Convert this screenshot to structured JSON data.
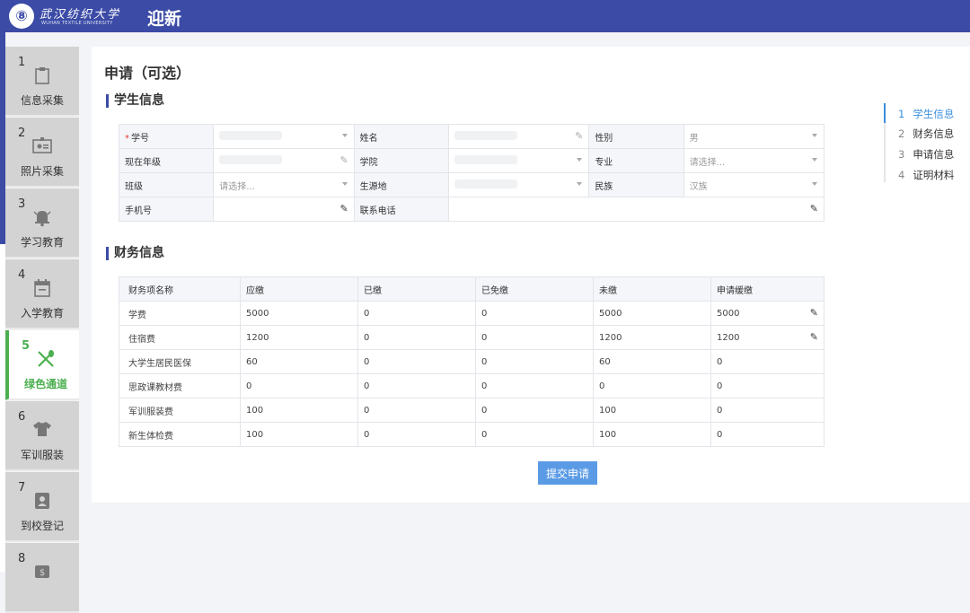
{
  "header": {
    "logo_glyph": "⑧",
    "university_name": "武汉纺织大学",
    "university_name_en": "WUHAN TEXTILE UNIVERSITY",
    "app_title": "迎新"
  },
  "sidebar": {
    "items": [
      {
        "num": "1",
        "label": "信息采集",
        "icon": "clipboard-icon"
      },
      {
        "num": "2",
        "label": "照片采集",
        "icon": "id-card-icon"
      },
      {
        "num": "3",
        "label": "学习教育",
        "icon": "bell-icon"
      },
      {
        "num": "4",
        "label": "入学教育",
        "icon": "calendar-icon"
      },
      {
        "num": "5",
        "label": "绿色通道",
        "icon": "fork-spoon-icon",
        "active": true
      },
      {
        "num": "6",
        "label": "军训服装",
        "icon": "tshirt-icon"
      },
      {
        "num": "7",
        "label": "到校登记",
        "icon": "badge-icon"
      },
      {
        "num": "8",
        "label": "",
        "icon": "money-icon"
      }
    ],
    "active_color": "#4caf50"
  },
  "page": {
    "title": "申请（可选）",
    "section_student": "学生信息",
    "section_finance": "财务信息",
    "submit_label": "提交申请"
  },
  "student_info": {
    "student_id_label": "学号",
    "name_label": "姓名",
    "gender_label": "性别",
    "gender_value": "男",
    "grade_label": "现在年级",
    "college_label": "学院",
    "major_label": "专业",
    "major_placeholder": "请选择...",
    "class_label": "班级",
    "class_placeholder": "请选择...",
    "origin_label": "生源地",
    "ethnicity_label": "民族",
    "ethnicity_value": "汉族",
    "phone_label": "手机号",
    "contact_label": "联系电话"
  },
  "finance": {
    "columns": [
      "财务项名称",
      "应缴",
      "已缴",
      "已免缴",
      "未缴",
      "申请缓缴"
    ],
    "rows": [
      [
        "学费",
        "5000",
        "0",
        "0",
        "5000",
        "5000"
      ],
      [
        "住宿费",
        "1200",
        "0",
        "0",
        "1200",
        "1200"
      ],
      [
        "大学生居民医保",
        "60",
        "0",
        "0",
        "60",
        "0"
      ],
      [
        "思政课教材费",
        "0",
        "0",
        "0",
        "0",
        "0"
      ],
      [
        "军训服装费",
        "100",
        "0",
        "0",
        "100",
        "0"
      ],
      [
        "新生体检费",
        "100",
        "0",
        "0",
        "100",
        "0"
      ]
    ]
  },
  "anchor_nav": {
    "items": [
      {
        "num": "1",
        "label": "学生信息"
      },
      {
        "num": "2",
        "label": "财务信息"
      },
      {
        "num": "3",
        "label": "申请信息"
      },
      {
        "num": "4",
        "label": "证明材料"
      }
    ],
    "active_color": "#3a8fdd"
  }
}
